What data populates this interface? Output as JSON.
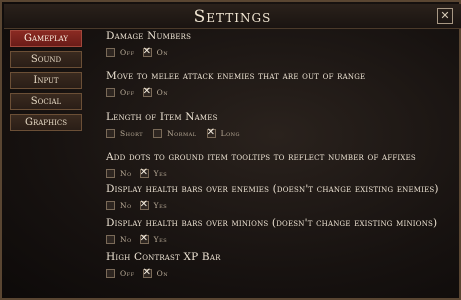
{
  "window": {
    "title": "Settings",
    "close_label": "✕"
  },
  "nav": {
    "items": [
      {
        "label": "Gameplay",
        "active": true
      },
      {
        "label": "Sound",
        "active": false
      },
      {
        "label": "Input",
        "active": false
      },
      {
        "label": "Social",
        "active": false
      },
      {
        "label": "Graphics",
        "active": false
      }
    ]
  },
  "options": [
    {
      "title": "Damage Numbers",
      "choices": [
        {
          "label": "Off",
          "checked": false
        },
        {
          "label": "On",
          "checked": true
        }
      ]
    },
    {
      "title": "Move to melee attack enemies that are out of range",
      "choices": [
        {
          "label": "Off",
          "checked": false
        },
        {
          "label": "On",
          "checked": true
        }
      ]
    },
    {
      "title": "Length of Item Names",
      "choices": [
        {
          "label": "Short",
          "checked": false
        },
        {
          "label": "Normal",
          "checked": false
        },
        {
          "label": "Long",
          "checked": true
        }
      ]
    },
    {
      "title": "Add dots to ground item tooltips to reflect number of affixes",
      "choices": [
        {
          "label": "No",
          "checked": false
        },
        {
          "label": "Yes",
          "checked": true
        }
      ]
    },
    {
      "title": "Display health bars over enemies (doesn't change existing enemies)",
      "choices": [
        {
          "label": "No",
          "checked": false
        },
        {
          "label": "Yes",
          "checked": true
        }
      ]
    },
    {
      "title": "Display health bars over minions (doesn't change existing minions)",
      "choices": [
        {
          "label": "No",
          "checked": false
        },
        {
          "label": "Yes",
          "checked": true
        }
      ]
    },
    {
      "title": "High Contrast XP Bar",
      "choices": [
        {
          "label": "Off",
          "checked": false
        },
        {
          "label": "On",
          "checked": true
        }
      ]
    }
  ]
}
